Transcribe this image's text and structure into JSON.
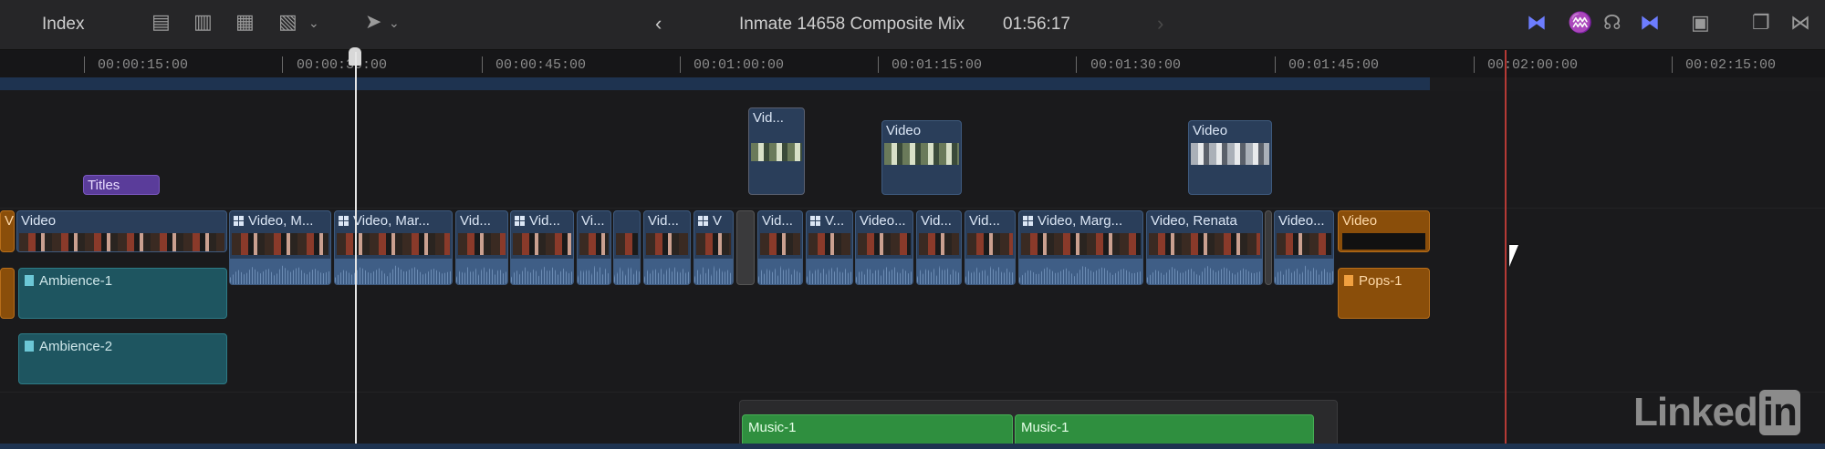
{
  "toolbar": {
    "index_label": "Index",
    "project_title": "Inmate 14658 Composite Mix",
    "duration": "01:56:17",
    "icons": [
      "append-icon",
      "insert-icon",
      "overwrite-icon",
      "connect-icon",
      "select-tool-icon",
      "back-icon",
      "forward-icon",
      "clip-skimming-icon",
      "audio-skimming-icon",
      "solo-icon",
      "snapping-icon",
      "clip-appearance-icon",
      "window-icon",
      "close-timeline-icon"
    ]
  },
  "ruler": {
    "timecodes": [
      "00:00:15:00",
      "00:00:30:00",
      "00:00:45:00",
      "00:01:00:00",
      "00:01:15:00",
      "00:01:30:00",
      "00:01:45:00",
      "00:02:00:00",
      "00:02:15:00"
    ]
  },
  "clips": {
    "titles": "Titles",
    "connected": [
      "Vid...",
      "Video",
      "Video"
    ],
    "primary": [
      {
        "label": "V",
        "type": "orange-video"
      },
      {
        "label": "Video"
      },
      {
        "label": "Video, M..."
      },
      {
        "label": "Video, Mar..."
      },
      {
        "label": "Vid..."
      },
      {
        "label": "Vid..."
      },
      {
        "label": "Vi..."
      },
      {
        "label": "Vid..."
      },
      {
        "label": "V"
      },
      {
        "label": "Vid..."
      },
      {
        "label": "V..."
      },
      {
        "label": "Video..."
      },
      {
        "label": "Vid..."
      },
      {
        "label": "Vid..."
      },
      {
        "label": "Video, Marg..."
      },
      {
        "label": "Video, Renata"
      },
      {
        "label": "Video..."
      },
      {
        "label": "Video",
        "type": "orange-video"
      }
    ],
    "audio": [
      "Ambience-1",
      "Ambience-2",
      "Pops-1"
    ],
    "music": [
      "Music-1",
      "Music-1"
    ]
  },
  "watermark": {
    "text": "Linked",
    "suffix": "in"
  },
  "colors": {
    "playhead": "#e6e6e6",
    "end_marker": "#b53a35",
    "video_clip": "#2a3e5a",
    "audio_teal": "#1e5560",
    "audio_orange": "#8a4e0a",
    "music_green": "#2f8f3f",
    "titles_purple": "#5a3c9a"
  }
}
